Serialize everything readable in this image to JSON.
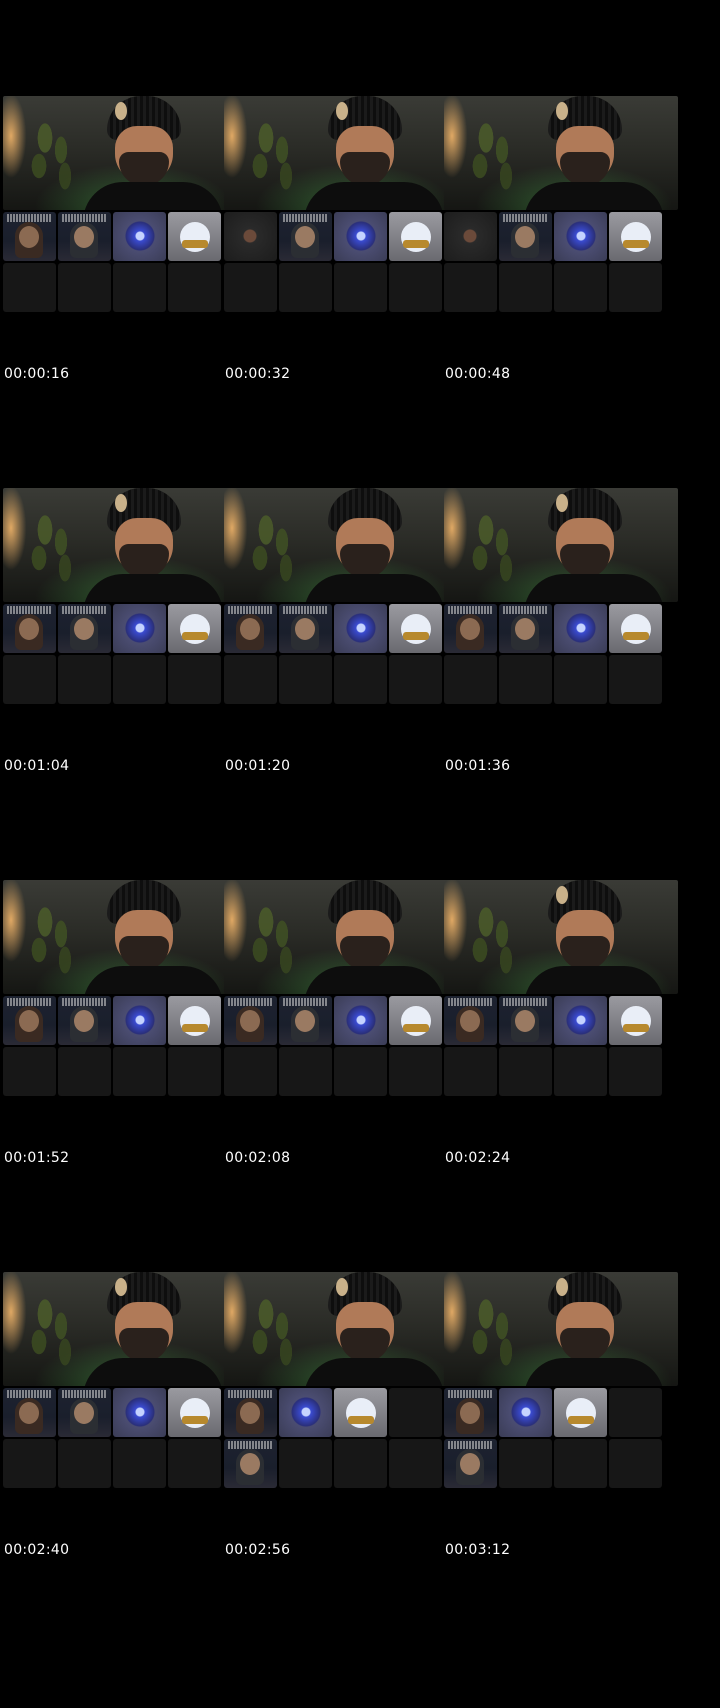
{
  "thumbnails": [
    {
      "time": "00:00:16"
    },
    {
      "time": "00:00:32"
    },
    {
      "time": "00:00:48"
    },
    {
      "time": "00:01:04"
    },
    {
      "time": "00:01:20"
    },
    {
      "time": "00:01:36"
    },
    {
      "time": "00:01:52"
    },
    {
      "time": "00:02:08"
    },
    {
      "time": "00:02:24"
    },
    {
      "time": "00:02:40"
    },
    {
      "time": "00:02:56"
    },
    {
      "time": "00:03:12"
    }
  ]
}
